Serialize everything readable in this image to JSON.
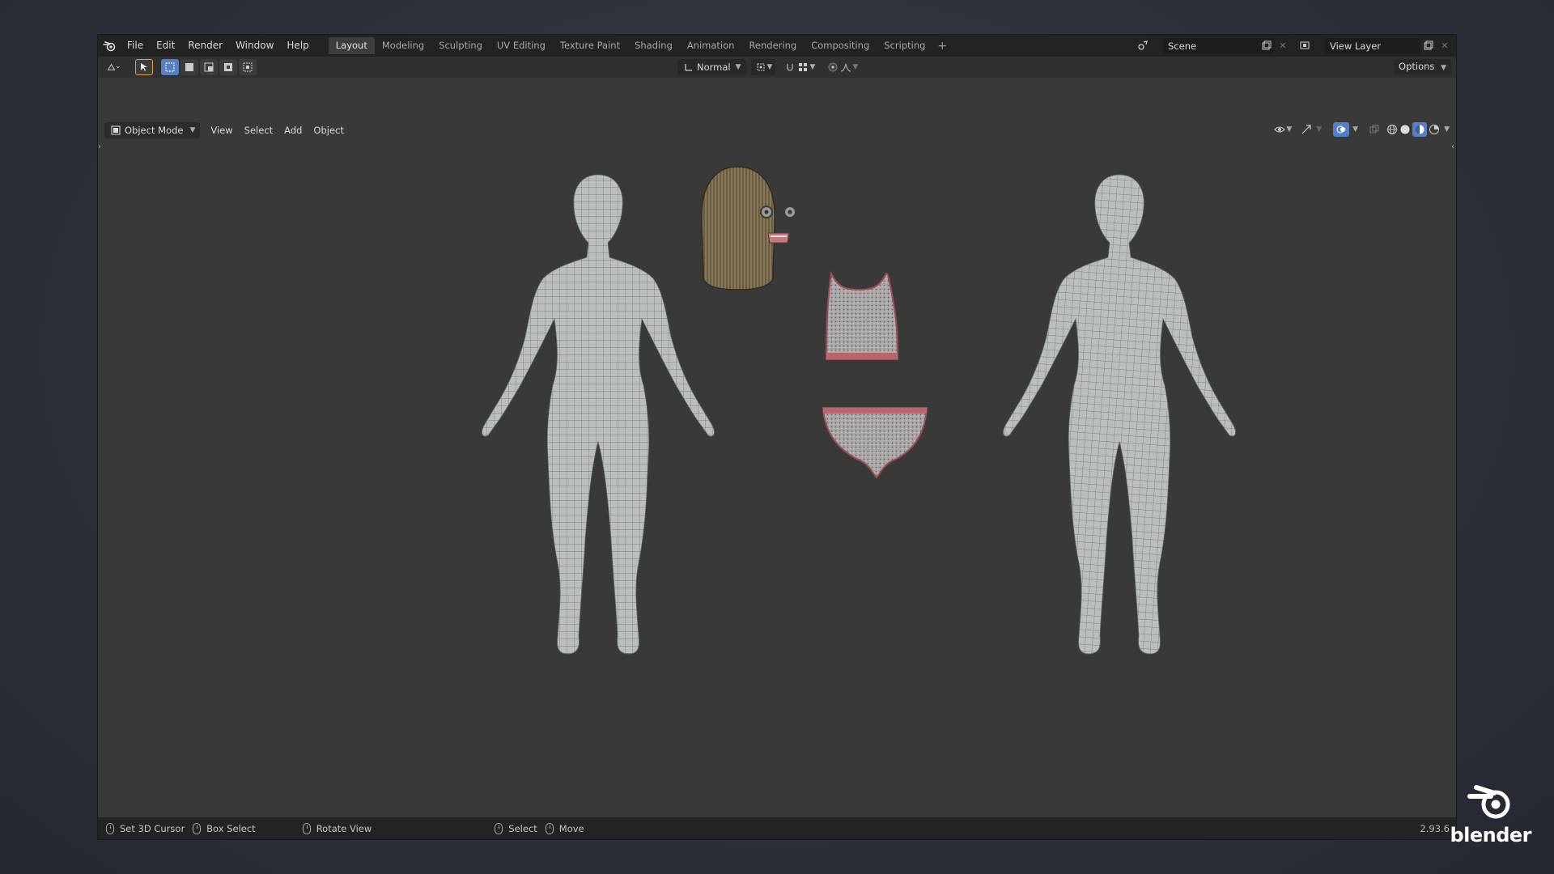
{
  "menubar": {
    "items": [
      "File",
      "Edit",
      "Render",
      "Window",
      "Help"
    ]
  },
  "workspaces": {
    "tabs": [
      "Layout",
      "Modeling",
      "Sculpting",
      "UV Editing",
      "Texture Paint",
      "Shading",
      "Animation",
      "Rendering",
      "Compositing",
      "Scripting"
    ],
    "active": "Layout"
  },
  "scene": {
    "name": "Scene"
  },
  "view_layer": {
    "name": "View Layer"
  },
  "toolbar": {
    "orientation": "Normal",
    "options_label": "Options"
  },
  "viewport_header": {
    "mode": "Object Mode",
    "menus": [
      "View",
      "Select",
      "Add",
      "Object"
    ]
  },
  "status_bar": {
    "items": [
      {
        "label": "Set 3D Cursor",
        "icon": "mouse-left-icon"
      },
      {
        "label": "Box Select",
        "icon": "mouse-left-drag-icon"
      },
      {
        "label": "Rotate View",
        "icon": "mouse-middle-icon"
      },
      {
        "label": "Select",
        "icon": "mouse-left-icon"
      },
      {
        "label": "Move",
        "icon": "mouse-left-drag-icon"
      }
    ],
    "version": "2.93.6"
  },
  "brand": {
    "text": "blender"
  },
  "colors": {
    "accent": "#5680c2",
    "viewport_bg": "#393939",
    "header_bg": "#232323",
    "mesh_fill": "#b9bdbc",
    "mesh_wire": "#5a5e5f",
    "hair": "#7a6a4a",
    "cloth_trim": "#b05a60"
  }
}
